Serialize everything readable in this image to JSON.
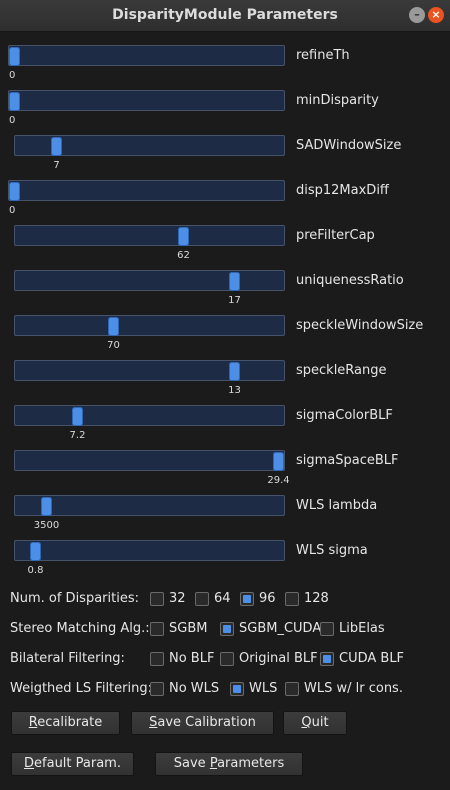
{
  "window": {
    "title": "DisparityModule Parameters"
  },
  "sliders": [
    {
      "label": "refineTh",
      "value": "0",
      "level": 0.0
    },
    {
      "label": "minDisparity",
      "value": "0",
      "level": 0.0
    },
    {
      "label": "SADWindowSize",
      "value": "7",
      "level": 0.14
    },
    {
      "label": "disp12MaxDiff",
      "value": "0",
      "level": 0.0
    },
    {
      "label": "preFilterCap",
      "value": "62",
      "level": 0.63
    },
    {
      "label": "uniquenessRatio",
      "value": "17",
      "level": 0.83
    },
    {
      "label": "speckleWindowSize",
      "value": "70",
      "level": 0.36
    },
    {
      "label": "speckleRange",
      "value": "13",
      "level": 0.83
    },
    {
      "label": "sigmaColorBLF",
      "value": "7.2",
      "level": 0.22
    },
    {
      "label": "sigmaSpaceBLF",
      "value": "29.4",
      "level": 1.0
    },
    {
      "label": "WLS lambda",
      "value": "3500",
      "level": 0.1
    },
    {
      "label": "WLS sigma",
      "value": "0.8",
      "level": 0.06
    }
  ],
  "options": {
    "disparities": {
      "label": "Num. of Disparities:",
      "choices": [
        "32",
        "64",
        "96",
        "128"
      ],
      "selected": "96"
    },
    "stereo": {
      "label": "Stereo Matching Alg.:",
      "choices": [
        "SGBM",
        "SGBM_CUDA",
        "LibElas"
      ],
      "selected": "SGBM_CUDA"
    },
    "bilateral": {
      "label": "Bilateral Filtering:",
      "choices": [
        "No BLF",
        "Original BLF",
        "CUDA BLF"
      ],
      "selected": "CUDA BLF"
    },
    "wls": {
      "label": "Weigthed LS Filtering:",
      "choices": [
        "No WLS",
        "WLS",
        "WLS w/ lr cons."
      ],
      "selected": "WLS"
    }
  },
  "buttons": {
    "recalibrate": {
      "first": "R",
      "rest": "ecalibrate"
    },
    "save_calibration": {
      "first": "S",
      "rest": "ave Calibration"
    },
    "quit": {
      "first": "Q",
      "rest": "uit"
    },
    "default_param": {
      "first": "D",
      "rest": "efault Param."
    },
    "save_parameters": {
      "pre": "Save ",
      "first": "P",
      "rest": "arameters"
    }
  },
  "colors": {
    "accent": "#4d8fe6",
    "track": "#1d2c44",
    "close": "#e95420"
  }
}
